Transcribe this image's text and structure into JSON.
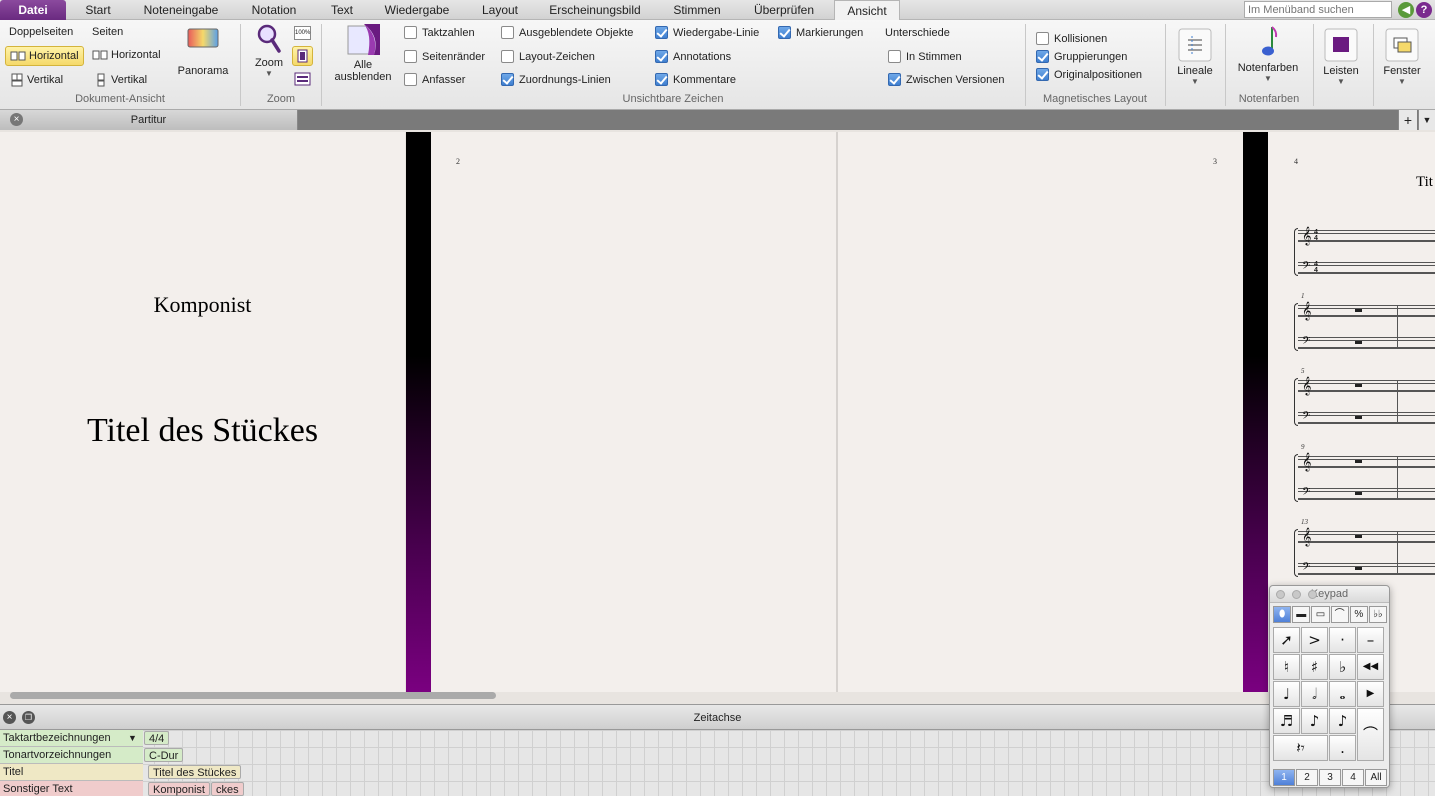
{
  "tabs": [
    "Datei",
    "Start",
    "Noteneingabe",
    "Notation",
    "Text",
    "Wiedergabe",
    "Layout",
    "Erscheinungsbild",
    "Stimmen",
    "Überprüfen",
    "Ansicht"
  ],
  "active_tab": "Ansicht",
  "search_placeholder": "Im Menüband suchen",
  "ribbon": {
    "document_view": {
      "label": "Dokument-Ansicht",
      "spreads": "Doppelseiten",
      "pages": "Seiten",
      "spreads_horizontal": "Horizontal",
      "spreads_vertical": "Vertikal",
      "pages_horizontal": "Horizontal",
      "pages_vertical": "Vertikal",
      "panorama": "Panorama"
    },
    "zoom": {
      "label": "Zoom",
      "zoom_button": "Zoom",
      "percent_icon_text": "100%"
    },
    "invisibles": {
      "label": "Unsichtbare Zeichen",
      "hide_all_line1": "Alle",
      "hide_all_line2": "ausblenden",
      "checkboxes": [
        {
          "label": "Taktzahlen",
          "checked": false
        },
        {
          "label": "Seitenränder",
          "checked": false
        },
        {
          "label": "Anfasser",
          "checked": false
        },
        {
          "label": "Ausgeblendete Objekte",
          "checked": false
        },
        {
          "label": "Layout-Zeichen",
          "checked": false
        },
        {
          "label": "Zuordnungs-Linien",
          "checked": true
        },
        {
          "label": "Wiedergabe-Linie",
          "checked": true
        },
        {
          "label": "Annotations",
          "checked": true
        },
        {
          "label": "Kommentare",
          "checked": true
        },
        {
          "label": "Markierungen",
          "checked": true
        }
      ],
      "differences_title": "Unterschiede",
      "differences": [
        {
          "label": "In Stimmen",
          "checked": false
        },
        {
          "label": "Zwischen Versionen",
          "checked": true
        }
      ]
    },
    "magnetic": {
      "label": "Magnetisches Layout",
      "checkboxes": [
        {
          "label": "Kollisionen",
          "checked": false
        },
        {
          "label": "Gruppierungen",
          "checked": true
        },
        {
          "label": "Originalpositionen",
          "checked": true
        }
      ]
    },
    "rulers": {
      "button": "Lineale"
    },
    "note_colors": {
      "button": "Notenfarben",
      "label": "Notenfarben"
    },
    "panels": {
      "button": "Leisten"
    },
    "window": {
      "button": "Fenster"
    }
  },
  "document_tab": "Partitur",
  "score": {
    "composer": "Komponist",
    "title": "Titel des Stückes",
    "page_numbers": [
      "2",
      "3",
      "4"
    ],
    "partial_title": "Tit",
    "measure_numbers": [
      "1",
      "5",
      "9",
      "13"
    ]
  },
  "timeline": {
    "title": "Zeitachse",
    "rows": [
      {
        "label": "Taktartbezeichnungen",
        "value": "4/4",
        "color": "#d5ebc8"
      },
      {
        "label": "Tonartvorzeichnungen",
        "value": "C-Dur",
        "color": "#d5ebc8"
      },
      {
        "label": "Titel",
        "value": "Titel des Stückes",
        "color": "#efe8c5"
      },
      {
        "label": "Sonstiger Text",
        "value": "Komponist",
        "value2": "ckes",
        "color": "#f0cccc"
      }
    ]
  },
  "keypad": {
    "title": "Keypad",
    "layouts": [
      "1",
      "2",
      "3",
      "4",
      "All"
    ],
    "active_layout": "1"
  },
  "colors": {
    "file_tab": "#6a2a80",
    "accent_blue": "#4f80d8",
    "selected_yellow": "#f5d96a"
  }
}
